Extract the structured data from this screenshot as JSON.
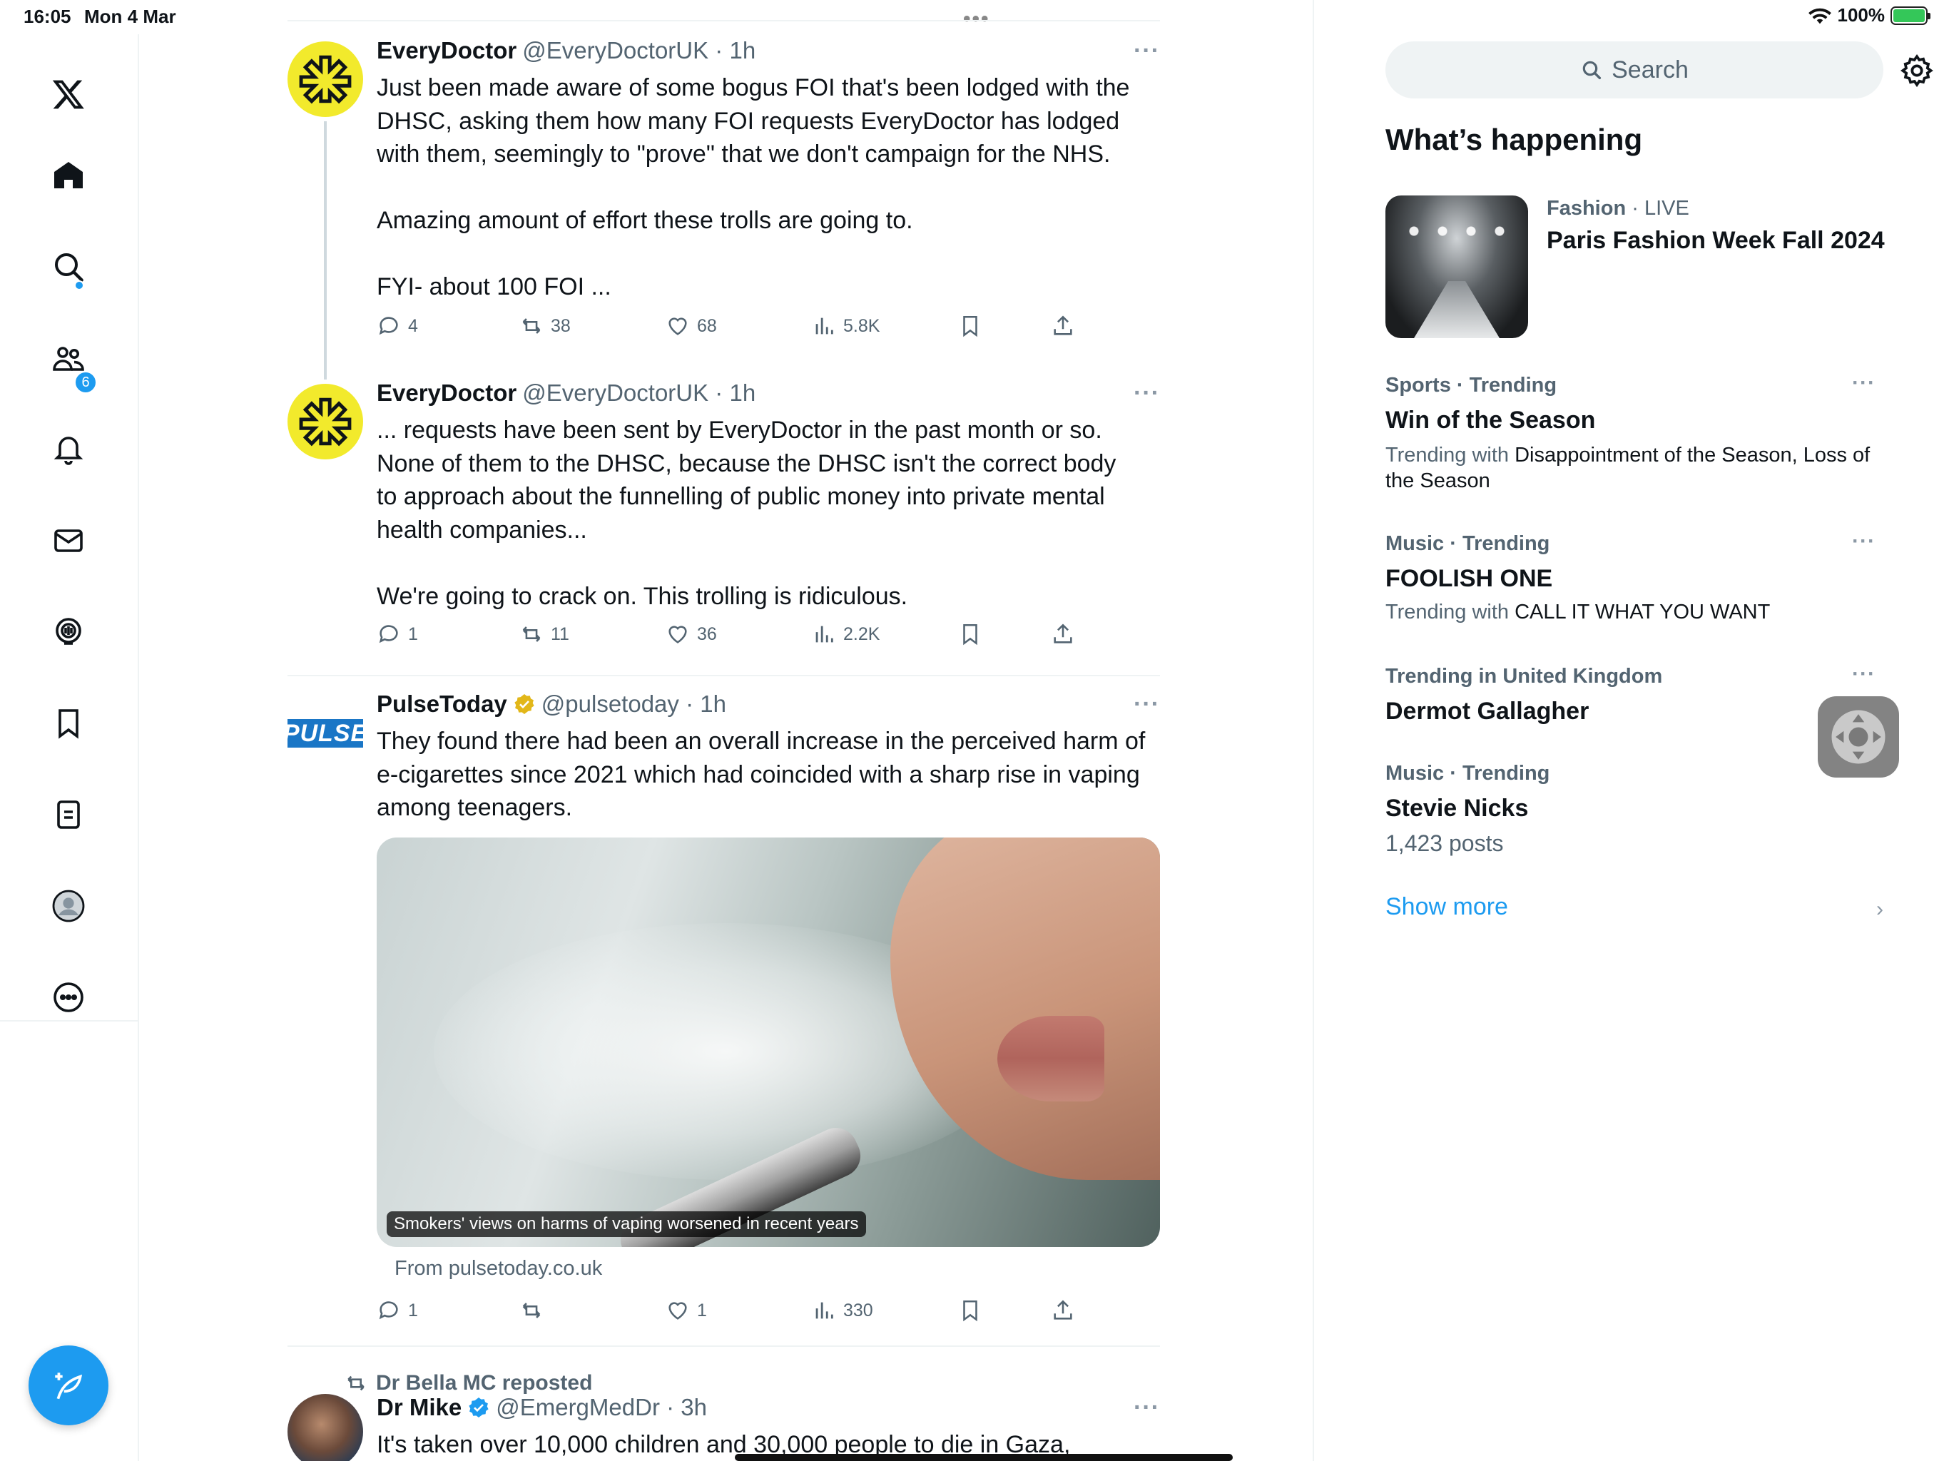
{
  "status_bar": {
    "time": "16:05",
    "date": "Mon 4 Mar",
    "battery": "100%"
  },
  "nav": {
    "notifications_count": "6",
    "items": [
      "x-logo-icon",
      "home-icon",
      "search-icon",
      "communities-icon",
      "notifications-icon",
      "messages-icon",
      "grok-icon",
      "bookmarks-icon",
      "lists-icon",
      "profile-icon",
      "more-icon"
    ]
  },
  "tweets": [
    {
      "name": "EveryDoctor",
      "handle": "@EveryDoctorUK · 1h",
      "text": "Just been made aware of some bogus FOI that's been lodged with the\nDHSC, asking them how many FOI requests EveryDoctor has lodged\nwith them, seemingly to \"prove\" that we don't campaign for the NHS.\n\nAmazing amount of effort these trolls are going to.\n\nFYI- about 100 FOI ...",
      "replies": "4",
      "reposts": "38",
      "likes": "68",
      "views": "5.8K"
    },
    {
      "name": "EveryDoctor",
      "handle": "@EveryDoctorUK · 1h",
      "text": "... requests have been sent by EveryDoctor in the past month or so.\nNone of them to the DHSC, because the DHSC isn't the correct body\nto approach about the funnelling of public money into private mental\nhealth companies...\n\nWe're going to crack on. This trolling is ridiculous.",
      "replies": "1",
      "reposts": "11",
      "likes": "36",
      "views": "2.2K"
    },
    {
      "name": "PulseToday",
      "handle": "@pulsetoday · 1h",
      "logo_text": "PULSE",
      "text": "They found there had been an overall increase in the perceived harm of\ne-cigarettes since 2021 which had coincided with a sharp rise in vaping\namong teenagers.",
      "media_caption": "Smokers' views on harms of vaping worsened in recent years",
      "from": "From pulsetoday.co.uk",
      "replies": "1",
      "reposts": "",
      "likes": "1",
      "views": "330"
    },
    {
      "repost_by": "Dr Bella MC reposted",
      "name": "Dr Mike",
      "handle": "@EmergMedDr · 3h",
      "text": "It's taken over 10,000 children and 30,000 people to die in Gaza,"
    }
  ],
  "sidebar": {
    "search_placeholder": "Search",
    "heading": "What’s happening",
    "featured": {
      "category": "Fashion",
      "live": " · LIVE",
      "title": "Paris Fashion Week Fall 2024"
    },
    "trends": [
      {
        "category": "Sports · Trending",
        "title": "Win of the Season",
        "with_label": "Trending with ",
        "with_names": "Disappointment of the Season, Loss of the Season"
      },
      {
        "category": "Music · Trending",
        "title": "FOOLISH ONE",
        "with_label": "Trending with ",
        "with_names": "CALL IT WHAT YOU WANT"
      },
      {
        "category": "Trending in United Kingdom",
        "title": "Dermot Gallagher"
      },
      {
        "category": "Music · Trending",
        "title": "Stevie Nicks",
        "posts": "1,423 posts"
      }
    ],
    "show_more": "Show more"
  },
  "colors": {
    "accent": "#1d9bf0",
    "text": "#0f1419",
    "secondary": "#536471",
    "everydoctor_yellow": "#f2ea2c"
  }
}
